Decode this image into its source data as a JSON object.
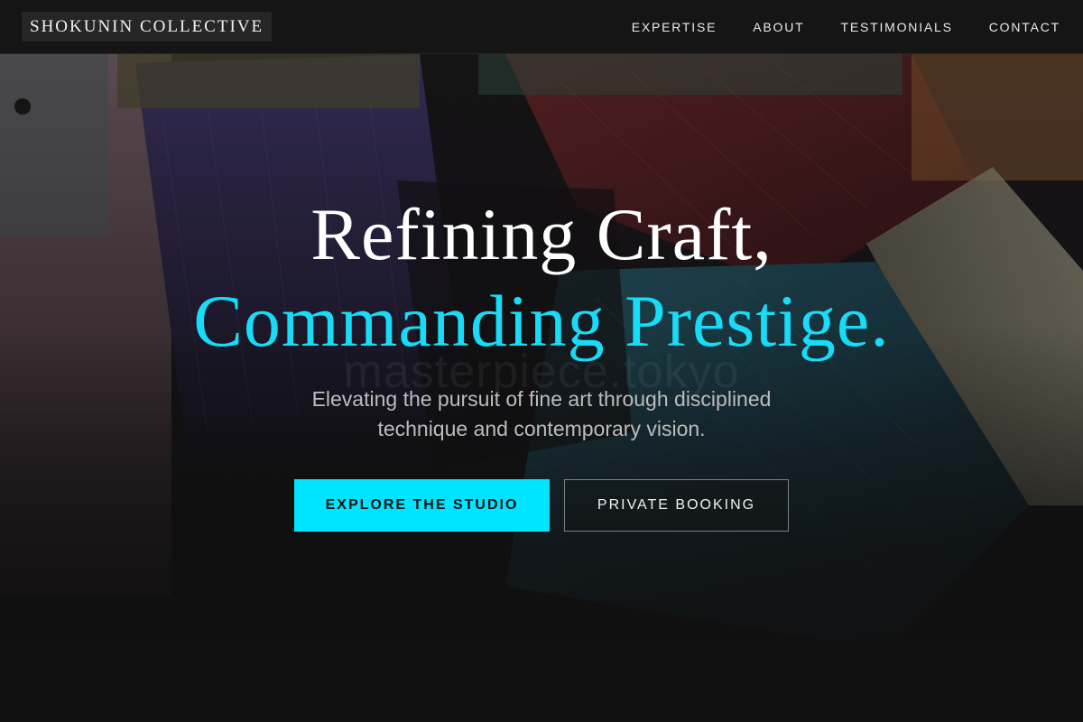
{
  "brand": {
    "name": "SHOKUNIN COLLECTIVE"
  },
  "nav": {
    "items": [
      {
        "label": "EXPERTISE"
      },
      {
        "label": "ABOUT"
      },
      {
        "label": "TESTIMONIALS"
      },
      {
        "label": "CONTACT"
      }
    ]
  },
  "hero": {
    "headline_line1": "Refining Craft,",
    "headline_line2": "Commanding Prestige.",
    "watermark": "masterpiece.tokyo",
    "subhead": "Elevating the pursuit of fine art through disciplined technique and contemporary vision.",
    "primary_cta": "EXPLORE THE STUDIO",
    "secondary_cta": "PRIVATE BOOKING"
  },
  "colors": {
    "accent": "#00e5ff",
    "headline_accent": "#18dcf7",
    "background": "#111111"
  }
}
